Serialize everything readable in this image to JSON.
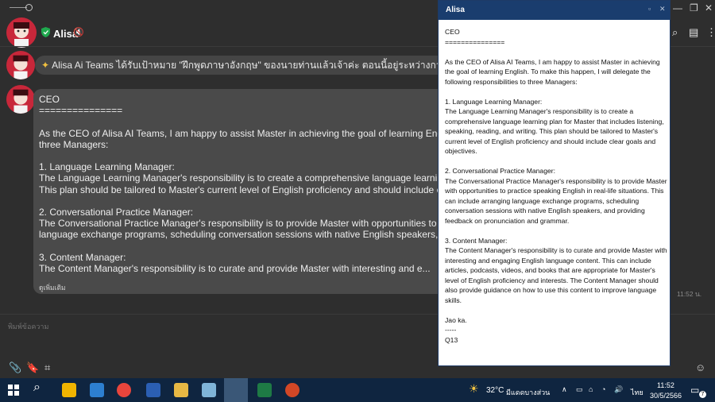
{
  "header": {
    "contact_name": "Alisa"
  },
  "messages": {
    "status_line": "Alisa Ai Teams ได้รับเป้าหมาย \"ฝึกพูดภาษาอังกฤษ\" ของนายท่านแล้วเจ้าค่ะ ตอนนี้อยู่ระหว่างการ Process นายท่านโปรดร",
    "bubble_text": "CEO\n===============\n\nAs the CEO of Alisa AI Teams, I am happy to assist Master in achieving the goal of learning English. To make\nthree Managers:\n\n1. Language Learning Manager:\nThe Language Learning Manager's responsibility is to create a comprehensive language learning plan for Ma\nThis plan should be tailored to Master's current level of English proficiency and should include clear goals an\n\n2. Conversational Practice Manager:\nThe Conversational Practice Manager's responsibility is to provide Master with opportunities to practice spea\nlanguage exchange programs, scheduling conversation sessions with native English speakers, and providing\n\n3. Content Manager:\nThe Content Manager's responsibility is to curate and provide Master with interesting and e...",
    "read_more": "ดูเพิ่มเติม",
    "timestamp": "11:52 น."
  },
  "input": {
    "placeholder": "พิมพ์ข้อความ"
  },
  "popup": {
    "title": "Alisa",
    "body": "CEO\n===============\n\nAs the CEO of Alisa AI Teams, I am happy to assist Master in achieving the goal of learning English. To make this happen, I will delegate the following responsibilities to three Managers:\n\n1. Language Learning Manager:\nThe Language Learning Manager's responsibility is to create a comprehensive language learning plan for Master that includes listening, speaking, reading, and writing. This plan should be tailored to Master's current level of English proficiency and should include clear goals and objectives.\n\n2. Conversational Practice Manager:\nThe Conversational Practice Manager's responsibility is to provide Master with opportunities to practice speaking English in real-life situations. This can include arranging language exchange programs, scheduling conversation sessions with native English speakers, and providing feedback on pronunciation and grammar.\n\n3. Content Manager:\nThe Content Manager's responsibility is to curate and provide Master with interesting and engaging English language content. This can include articles, podcasts, videos, and books that are appropriate for Master's level of English proficiency and interests. The Content Manager should also provide guidance on how to use this content to improve language skills.\n\nJao ka.\n-----\nQ13"
  },
  "taskbar": {
    "weather_temp": "32°C",
    "weather_desc": "มีแดดบางส่วน",
    "language": "ไทย",
    "time": "11:52",
    "date": "30/5/2566",
    "notification_count": "7"
  },
  "colors": {
    "popup_title_bg": "#1a3d6e",
    "bubble_bg": "#4a4a4a",
    "taskbar_bg": "#0f2540"
  }
}
